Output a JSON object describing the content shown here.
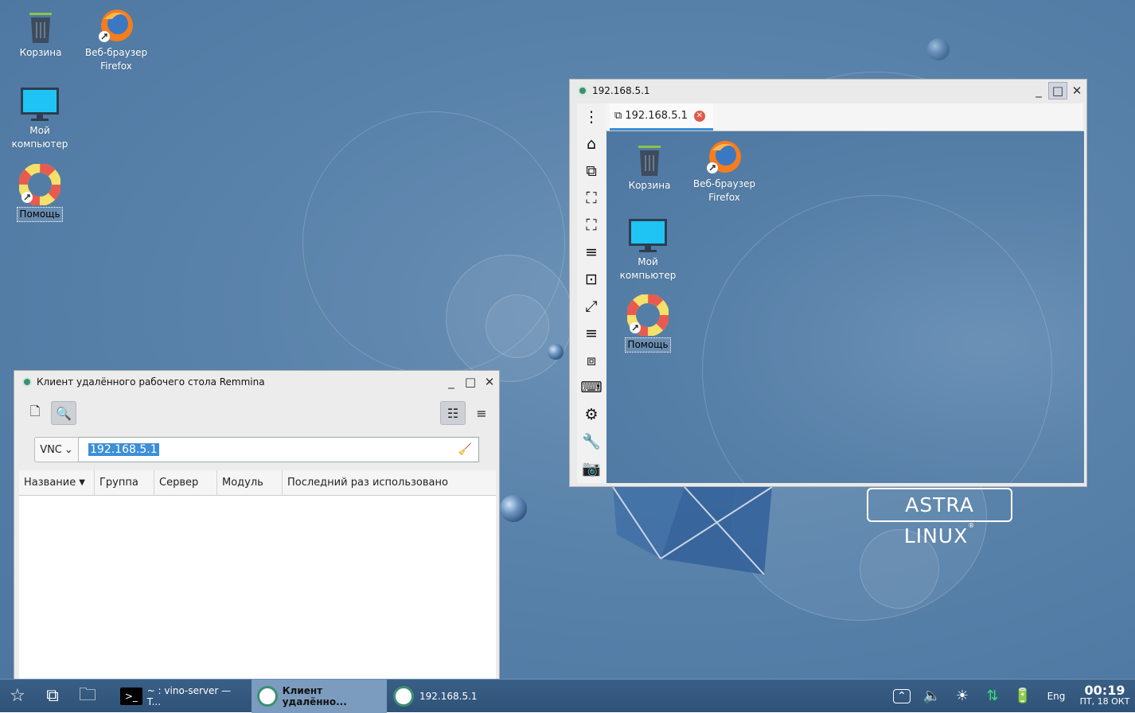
{
  "desktop": {
    "icons": [
      {
        "label": "Корзина"
      },
      {
        "label": "Веб-браузер Firefox"
      },
      {
        "label": "Мой компьютер"
      },
      {
        "label": "Помощь"
      }
    ],
    "logo_text": "ASTRA LINUX",
    "logo_mark": "®"
  },
  "remote_window": {
    "title": "192.168.5.1",
    "tab_label": "192.168.5.1",
    "remote_icons": [
      {
        "label": "Корзина"
      },
      {
        "label": "Веб-браузер Firefox"
      },
      {
        "label": "Мой компьютер"
      },
      {
        "label": "Помощь"
      }
    ]
  },
  "remmina": {
    "title": "Клиент удалённого рабочего стола Remmina",
    "protocol": "VNC",
    "address": "192.168.5.1",
    "columns": [
      "Название",
      "Группа",
      "Сервер",
      "Модуль",
      "Последний раз использовано"
    ]
  },
  "taskbar": {
    "tasks": [
      {
        "label": "~ : vino-server — T..."
      },
      {
        "label": "Клиент удалённо..."
      },
      {
        "label": "192.168.5.1"
      }
    ],
    "lang": "Eng",
    "time": "00:19",
    "date": "ПТ, 18 ОКТ"
  },
  "colors": {
    "accent": "#3d8fd6",
    "desktop": "#5a83ab",
    "taskbar": "#2f5277"
  }
}
